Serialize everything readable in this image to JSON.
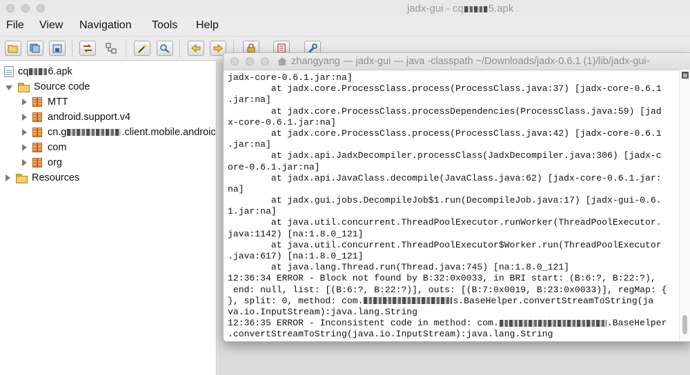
{
  "window": {
    "title_prefix": "jadx-gui - cq",
    "title_suffix": "5.apk"
  },
  "menu": [
    "File",
    "View",
    "Navigation",
    "Tools",
    "Help"
  ],
  "toolbar": {
    "buttons": [
      "open-file",
      "save-all",
      "export",
      "sync",
      "flatten-packages",
      "decompile-all",
      "search",
      "back",
      "forward",
      "preferences",
      "log",
      "settings"
    ]
  },
  "tree": {
    "root_prefix": "cq",
    "root_suffix": "6.apk",
    "source_code": "Source code",
    "packages": {
      "mtt": "MTT",
      "android_support": "android.support.v4",
      "cn_prefix": "cn.g",
      "cn_suffix": ".client.mobile.androic",
      "com": "com",
      "org": "org"
    },
    "resources": "Resources"
  },
  "terminal": {
    "title": "zhangyang — jadx-gui — java -classpath ~/Downloads/jadx-0.6.1 (1)/lib/jadx-gui-",
    "lines": [
      "jadx-core-0.6.1.jar:na]",
      "        at jadx.core.ProcessClass.process(ProcessClass.java:37) [jadx-core-0.6.1",
      ".jar:na]",
      "        at jadx.core.ProcessClass.processDependencies(ProcessClass.java:59) [jad",
      "x-core-0.6.1.jar:na]",
      "        at jadx.core.ProcessClass.process(ProcessClass.java:42) [jadx-core-0.6.1",
      ".jar:na]",
      "        at jadx.api.JadxDecompiler.processClass(JadxDecompiler.java:306) [jadx-c",
      "ore-0.6.1.jar:na]",
      "        at jadx.api.JavaClass.decompile(JavaClass.java:62) [jadx-core-0.6.1.jar:",
      "na]",
      "        at jadx.gui.jobs.DecompileJob$1.run(DecompileJob.java:17) [jadx-gui-0.6.",
      "1.jar:na]",
      "        at java.util.concurrent.ThreadPoolExecutor.runWorker(ThreadPoolExecutor.",
      "java:1142) [na:1.8.0_121]",
      "        at java.util.concurrent.ThreadPoolExecutor$Worker.run(ThreadPoolExecutor",
      ".java:617) [na:1.8.0_121]",
      "        at java.lang.Thread.run(Thread.java:745) [na:1.8.0_121]",
      "12:36:34 ERROR - Block not found by B:32:0x0033, in BRI start: (B:6:?, B:22:?),",
      " end: null, list: [(B:6:?, B:22:?)], outs: [(B:7:0x0019, B:23:0x0033)], regMap: {",
      "}, split: 0, method: com.",
      "s.BaseHelper.convertStreamToString(ja",
      "va.io.InputStream):java.lang.String",
      "12:36:35 ERROR - Inconsistent code in method: com.",
      ".BaseHelper",
      ".convertStreamToString(java.io.InputStream):java.lang.String"
    ]
  }
}
